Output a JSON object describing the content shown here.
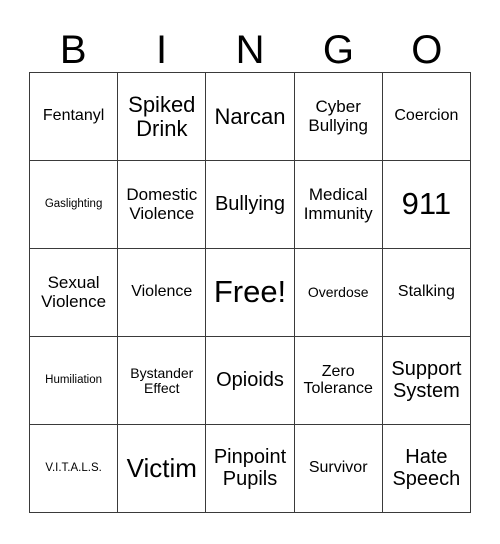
{
  "card": {
    "title_letters": [
      "B",
      "I",
      "N",
      "G",
      "O"
    ],
    "grid": {
      "columns": 5,
      "rows": 5,
      "border_color": "#3a3a3a",
      "background_color": "#ffffff",
      "text_color": "#000000"
    },
    "cells": [
      {
        "text": "Fentanyl",
        "size": "fs-m",
        "column": "B",
        "row": 1
      },
      {
        "text": "Spiked\nDrink",
        "size": "fs-xl",
        "column": "I",
        "row": 1
      },
      {
        "text": "Narcan",
        "size": "fs-xl",
        "column": "N",
        "row": 1
      },
      {
        "text": "Cyber\nBullying",
        "size": "fs-ml",
        "column": "G",
        "row": 1
      },
      {
        "text": "Coercion",
        "size": "fs-m",
        "column": "O",
        "row": 1
      },
      {
        "text": "Gaslighting",
        "size": "fs-xs",
        "column": "B",
        "row": 2
      },
      {
        "text": "Domestic\nViolence",
        "size": "fs-ml",
        "column": "I",
        "row": 2
      },
      {
        "text": "Bullying",
        "size": "fs-l",
        "column": "N",
        "row": 2
      },
      {
        "text": "Medical\nImmunity",
        "size": "fs-ml",
        "column": "G",
        "row": 2
      },
      {
        "text": "911",
        "size": "fs-huge",
        "column": "O",
        "row": 2
      },
      {
        "text": "Sexual\nViolence",
        "size": "fs-ml",
        "column": "B",
        "row": 3
      },
      {
        "text": "Violence",
        "size": "fs-m",
        "column": "I",
        "row": 3
      },
      {
        "text": "Free!",
        "size": "fs-huge",
        "column": "N",
        "row": 3
      },
      {
        "text": "Overdose",
        "size": "fs-s",
        "column": "G",
        "row": 3
      },
      {
        "text": "Stalking",
        "size": "fs-m",
        "column": "O",
        "row": 3
      },
      {
        "text": "Humiliation",
        "size": "fs-xs",
        "column": "B",
        "row": 4
      },
      {
        "text": "Bystander\nEffect",
        "size": "fs-s",
        "column": "I",
        "row": 4
      },
      {
        "text": "Opioids",
        "size": "fs-l",
        "column": "N",
        "row": 4
      },
      {
        "text": "Zero\nTolerance",
        "size": "fs-m",
        "column": "G",
        "row": 4
      },
      {
        "text": "Support\nSystem",
        "size": "fs-l",
        "column": "O",
        "row": 4
      },
      {
        "text": "V.I.T.A.L.S.",
        "size": "fs-xs",
        "column": "B",
        "row": 5
      },
      {
        "text": "Victim",
        "size": "fs-xxl",
        "column": "I",
        "row": 5
      },
      {
        "text": "Pinpoint\nPupils",
        "size": "fs-l",
        "column": "N",
        "row": 5
      },
      {
        "text": "Survivor",
        "size": "fs-m",
        "column": "G",
        "row": 5
      },
      {
        "text": "Hate\nSpeech",
        "size": "fs-l",
        "column": "O",
        "row": 5
      }
    ]
  }
}
